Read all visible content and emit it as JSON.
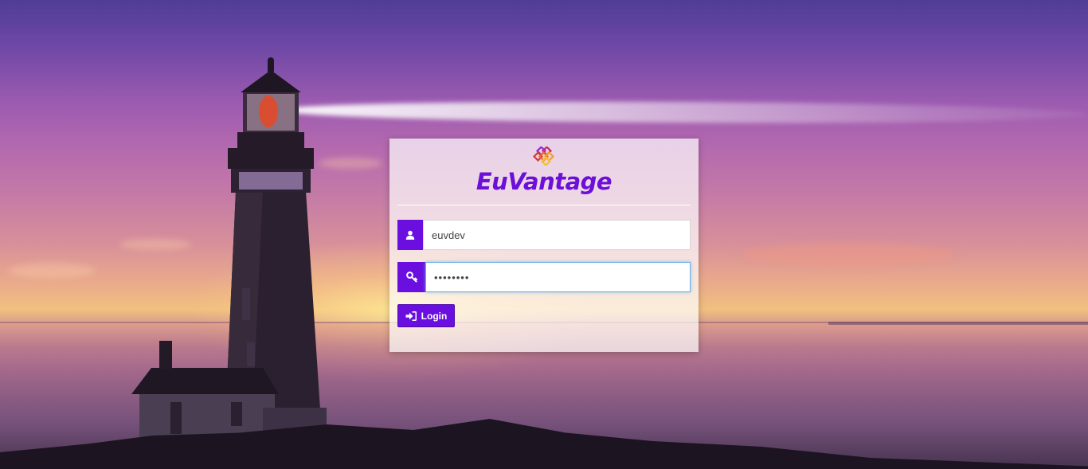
{
  "brand": {
    "name": "EuVantage",
    "logo_icon": "interlocking-knot-icon",
    "color": "#6b0fd9"
  },
  "login_form": {
    "username": {
      "icon": "user-icon",
      "value": "euvdev"
    },
    "password": {
      "icon": "key-icon",
      "value": "••••••••"
    },
    "submit": {
      "icon": "sign-in-icon",
      "label": "Login"
    }
  },
  "colors": {
    "accent": "#6a0fdf",
    "focus_border": "#66afe9"
  }
}
